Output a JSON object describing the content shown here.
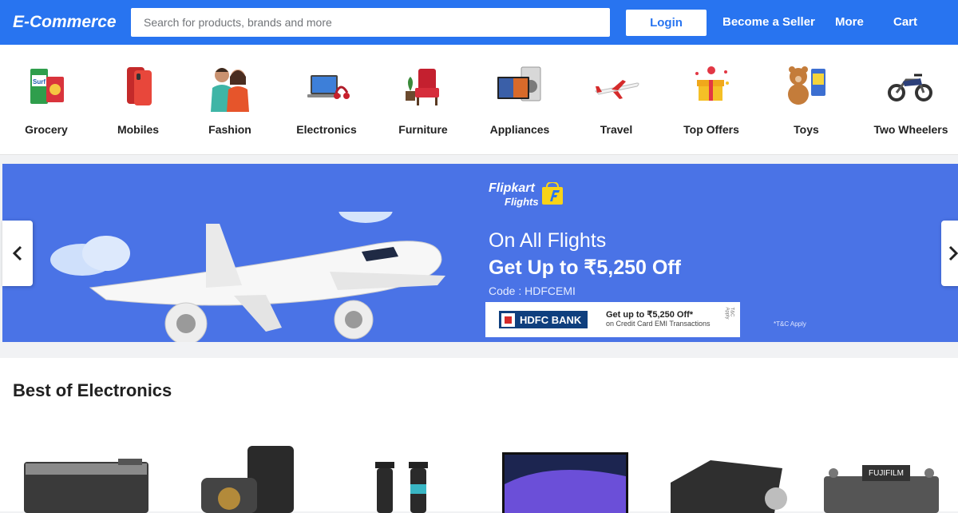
{
  "header": {
    "logo": "E-Commerce",
    "search_placeholder": "Search for products, brands and more",
    "login": "Login",
    "become_seller": "Become a Seller",
    "more": "More",
    "cart": "Cart"
  },
  "categories": [
    {
      "label": "Grocery",
      "icon": "grocery-icon"
    },
    {
      "label": "Mobiles",
      "icon": "mobile-phone-icon"
    },
    {
      "label": "Fashion",
      "icon": "fashion-icon"
    },
    {
      "label": "Electronics",
      "icon": "laptop-icon"
    },
    {
      "label": "Furniture",
      "icon": "armchair-icon"
    },
    {
      "label": "Appliances",
      "icon": "appliances-icon"
    },
    {
      "label": "Travel",
      "icon": "airplane-icon"
    },
    {
      "label": "Top Offers",
      "icon": "gift-icon"
    },
    {
      "label": "Toys",
      "icon": "teddy-bear-icon"
    },
    {
      "label": "Two Wheelers",
      "icon": "motorcycle-icon"
    }
  ],
  "banner": {
    "brand_line1": "Flipkart",
    "brand_line2": "Flights",
    "headline": "On All Flights",
    "offer": "Get Up to ₹5,250 Off",
    "code": "Code : HDFCEMI",
    "bank_name": "HDFC BANK",
    "bank_offer": "Get up to ₹5,250 Off*",
    "bank_offer_sub": "on Credit Card EMI Transactions",
    "bank_tc": "T&C Apply",
    "tc": "*T&C Apply",
    "colors": {
      "background": "#4a73e6",
      "accent": "#2874f0"
    }
  },
  "section": {
    "title": "Best of Electronics",
    "products": [
      "printer",
      "power-bank",
      "trimmer",
      "monitor",
      "projector",
      "camera"
    ]
  }
}
